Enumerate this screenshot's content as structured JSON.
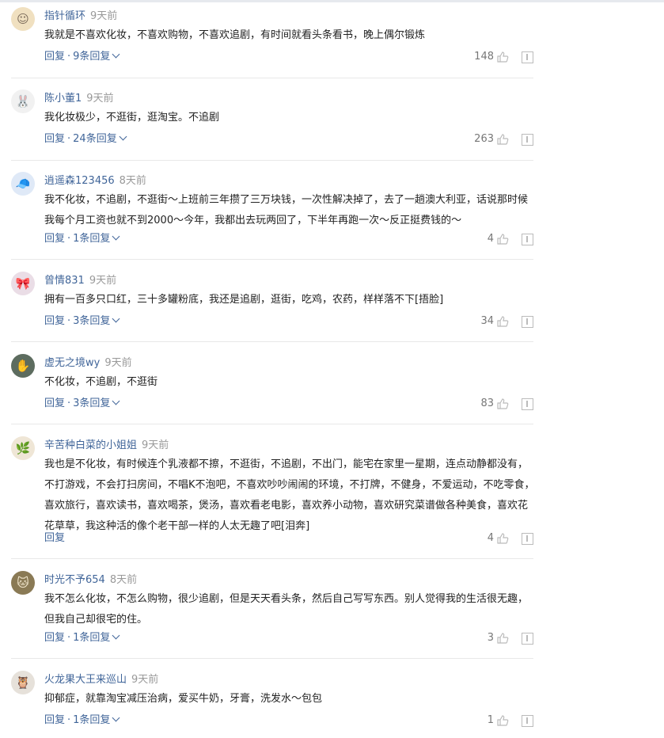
{
  "comments": [
    {
      "user": "指针循环",
      "time": "9天前",
      "text": "我就是不喜欢化妆，不喜欢购物，不喜欢追剧，有时间就看头条看书，晚上偶尔锻炼",
      "reply_label": "回复",
      "replies_label": "9条回复",
      "likes": "148",
      "avatar_icon": "user-avatar-icon"
    },
    {
      "user": "陈小董1",
      "time": "9天前",
      "text": "我化妆极少，不逛街，逛淘宝。不追剧",
      "reply_label": "回复",
      "replies_label": "24条回复",
      "likes": "263",
      "avatar_icon": "user-avatar-icon"
    },
    {
      "user": "逍遥森123456",
      "time": "8天前",
      "text": "我不化妆，不追剧，不逛街～上班前三年攒了三万块钱，一次性解决掉了，去了一趟澳大利亚，话说那时候我每个月工资也就不到2000～今年，我都出去玩两回了，下半年再跑一次～反正挺费钱的～",
      "reply_label": "回复",
      "replies_label": "1条回复",
      "likes": "4",
      "avatar_icon": "user-avatar-icon"
    },
    {
      "user": "曾情831",
      "time": "9天前",
      "text": "拥有一百多只口红，三十多罐粉底，我还是追剧，逛街，吃鸡，农药，样样落不下[捂脸]",
      "reply_label": "回复",
      "replies_label": "3条回复",
      "likes": "34",
      "avatar_icon": "user-avatar-icon"
    },
    {
      "user": "虚无之境wy",
      "time": "9天前",
      "text": "不化妆，不追剧，不逛街",
      "reply_label": "回复",
      "replies_label": "3条回复",
      "likes": "83",
      "avatar_icon": "user-avatar-icon"
    },
    {
      "user": "辛苦种白菜的小姐姐",
      "time": "9天前",
      "text": "我也是不化妆，有时候连个乳液都不擦，不逛街，不追剧，不出门，能宅在家里一星期，连点动静都没有，不打游戏，不会打扫房间，不唱K不泡吧，不喜欢吵吵闹闹的环境，不打牌，不健身，不爱运动，不吃零食，喜欢旅行，喜欢读书，喜欢喝茶，煲汤，喜欢看老电影，喜欢养小动物，喜欢研究菜谱做各种美食，喜欢花花草草，我这种活的像个老干部一样的人太无趣了吧[泪奔]",
      "reply_label": "回复",
      "replies_label": "",
      "likes": "4",
      "avatar_icon": "user-avatar-icon"
    },
    {
      "user": "时光不予654",
      "time": "8天前",
      "text": "我不怎么化妆，不怎么购物，很少追剧，但是天天看头条，然后自己写写东西。别人觉得我的生活很无趣，但我自己却很宅的住。",
      "reply_label": "回复",
      "replies_label": "1条回复",
      "likes": "3",
      "avatar_icon": "user-avatar-icon"
    },
    {
      "user": "火龙果大王来巡山",
      "time": "9天前",
      "text": "抑郁症，就靠淘宝减压治病，爱买牛奶，牙膏，洗发水～包包",
      "reply_label": "回复",
      "replies_label": "1条回复",
      "likes": "1",
      "avatar_icon": "user-avatar-icon"
    }
  ]
}
